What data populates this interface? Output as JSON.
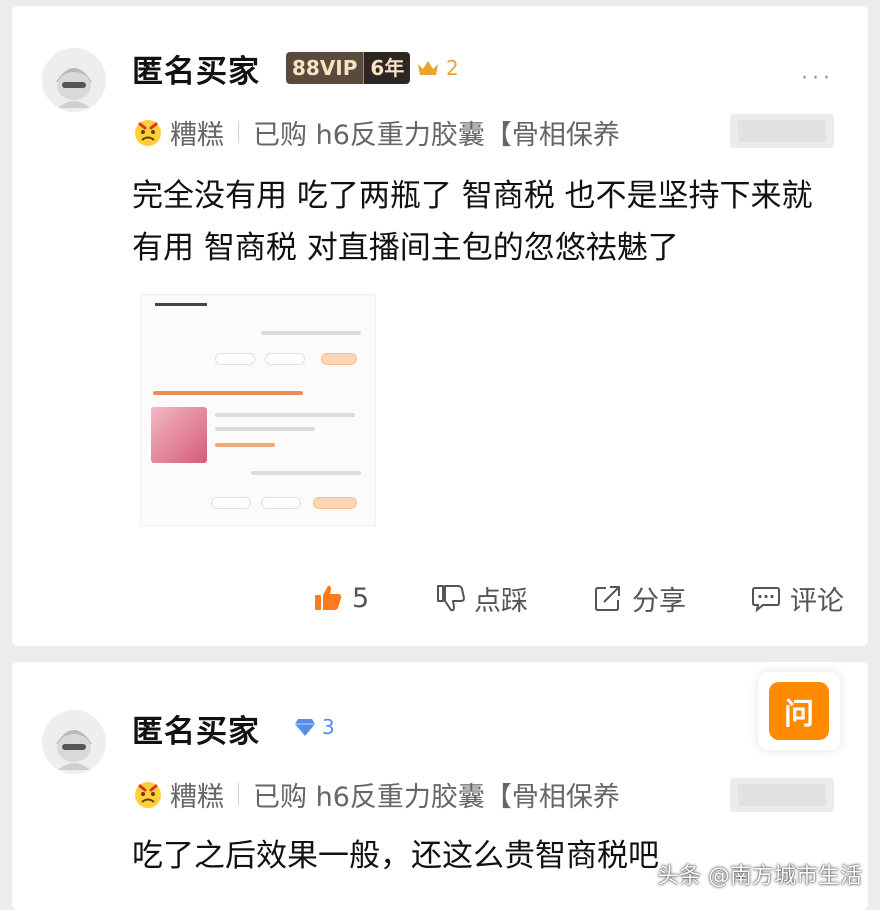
{
  "reviews": [
    {
      "username": "匿名买家",
      "vip_label": "88VIP",
      "vip_years": "6年",
      "level": "2",
      "level_icon": "crown-icon",
      "more": "···",
      "flavor": "糟糕",
      "purchased": "已购 h6反重力胶囊【骨相保养",
      "text": "完全没有用 吃了两瓶了 智商税 也不是坚持下来就有用  智商税 对直播间主包的忽悠祛魅了",
      "actions": {
        "like_count": "5",
        "dislike_label": "点踩",
        "share_label": "分享",
        "comment_label": "评论"
      }
    },
    {
      "username": "匿名买家",
      "level": "3",
      "level_icon": "diamond-icon",
      "flavor": "糟糕",
      "purchased": "已购 h6反重力胶囊【骨相保养",
      "text": "吃了之后效果一般，还这么贵智商税吧"
    }
  ],
  "ask_button_label": "问",
  "watermark": "头条 @南方城市生活",
  "colors": {
    "like_orange": "#ff7a1a",
    "ask_orange": "#ff8a00",
    "crown_gold": "#e8a532",
    "diamond_blue": "#5a8ee6"
  }
}
